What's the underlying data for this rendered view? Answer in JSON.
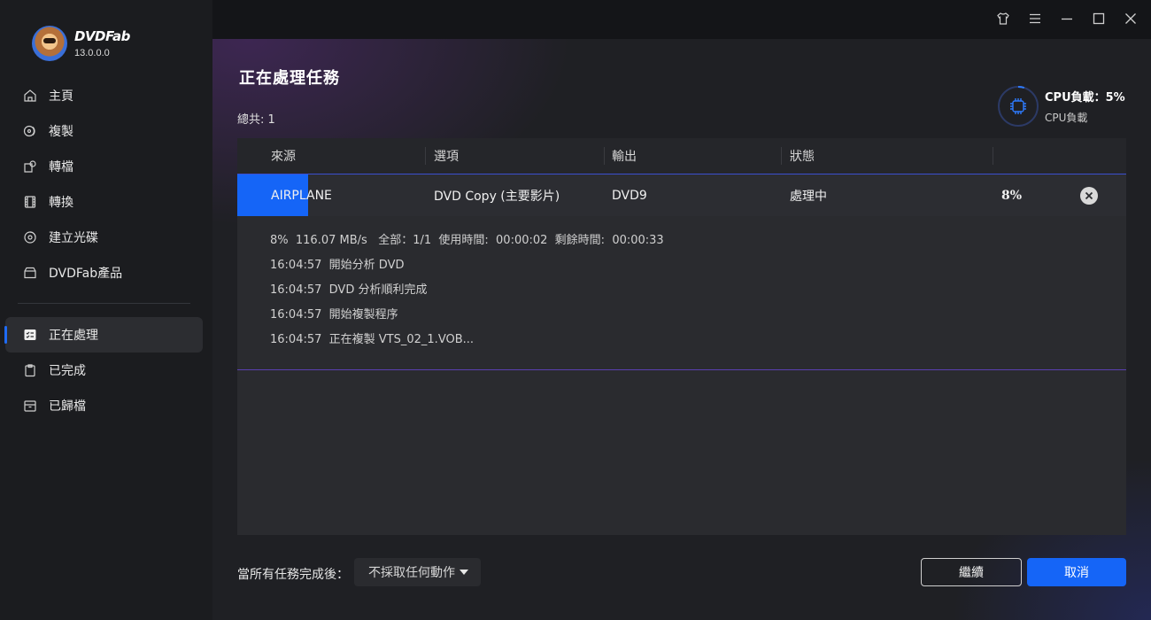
{
  "app": {
    "name": "DVDFab",
    "version": "13.0.0.0"
  },
  "sidebar": {
    "items": [
      {
        "label": "主頁",
        "icon": "home-icon"
      },
      {
        "label": "複製",
        "icon": "copy-disc-icon"
      },
      {
        "label": "轉檔",
        "icon": "ripper-icon"
      },
      {
        "label": "轉換",
        "icon": "film-convert-icon"
      },
      {
        "label": "建立光碟",
        "icon": "disc-create-icon"
      },
      {
        "label": "DVDFab產品",
        "icon": "products-box-icon"
      },
      {
        "label": "正在處理",
        "icon": "task-list-icon"
      },
      {
        "label": "已完成",
        "icon": "completed-clipboard-icon"
      },
      {
        "label": "已歸檔",
        "icon": "archive-box-icon"
      }
    ],
    "active_index": 6
  },
  "page": {
    "title": "正在處理任務",
    "total_label": "總共: 1"
  },
  "cpu": {
    "label": "CPU負載：5%",
    "sub_label": "CPU負載",
    "load_percent": 5
  },
  "table": {
    "headers": [
      "來源",
      "選項",
      "輸出",
      "狀態"
    ],
    "row": {
      "source": "AIRPLANE",
      "option": "DVD Copy (主要影片)",
      "output": "DVD9",
      "status": "處理中",
      "percent_text": "8%",
      "progress_percent": 8
    },
    "details": {
      "stats": "8%  116.07 MB/s   全部：1/1  使用時間:  00:00:02  剩餘時間:  00:00:33",
      "log": [
        "16:04:57  開始分析 DVD",
        "16:04:57  DVD 分析順利完成",
        "16:04:57  開始複製程序",
        "16:04:57  正在複製 VTS_02_1.VOB..."
      ]
    }
  },
  "footer": {
    "after_all_label": "當所有任務完成後：",
    "after_all_value": "不採取任何動作",
    "continue_label": "繼續",
    "cancel_label": "取消"
  },
  "colors": {
    "accent": "#1565f7",
    "sidebar_bg": "#1b1c1f",
    "panel_bg": "#2a2b2f"
  }
}
